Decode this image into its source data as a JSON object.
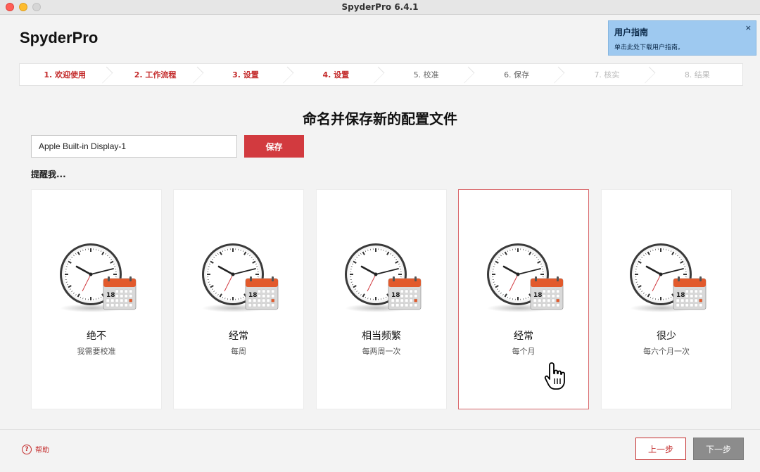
{
  "window": {
    "title": "SpyderPro 6.4.1"
  },
  "app": {
    "logo": "SpyderPro"
  },
  "guide": {
    "title": "用户指南",
    "subtitle": "单击此处下载用户指南。",
    "close": "×"
  },
  "steps": [
    {
      "label": "1. 欢迎使用",
      "state": "done"
    },
    {
      "label": "2. 工作流程",
      "state": "done"
    },
    {
      "label": "3. 设置",
      "state": "done"
    },
    {
      "label": "4. 设置",
      "state": "done"
    },
    {
      "label": "5. 校准",
      "state": "pending"
    },
    {
      "label": "6. 保存",
      "state": "pending"
    },
    {
      "label": "7. 核实",
      "state": "disabled"
    },
    {
      "label": "8. 结果",
      "state": "disabled"
    }
  ],
  "main": {
    "heading": "命名并保存新的配置文件",
    "profile_name_value": "Apple Built-in Display-1",
    "save_label": "保存",
    "remind_label": "提醒我..."
  },
  "calendar_day": "18",
  "cards": [
    {
      "title": "绝不",
      "subtitle": "我需要校准",
      "selected": false
    },
    {
      "title": "经常",
      "subtitle": "每周",
      "selected": false
    },
    {
      "title": "相当频繁",
      "subtitle": "每两周一次",
      "selected": false
    },
    {
      "title": "经常",
      "subtitle": "每个月",
      "selected": true
    },
    {
      "title": "很少",
      "subtitle": "每六个月一次",
      "selected": false
    }
  ],
  "footer": {
    "help_label": "帮助",
    "help_icon_glyph": "?",
    "back_label": "上一步",
    "next_label": "下一步"
  },
  "colors": {
    "accent": "#d23a3f",
    "guide_bg": "#9ec9f0",
    "next_disabled": "#8c8c8c"
  }
}
